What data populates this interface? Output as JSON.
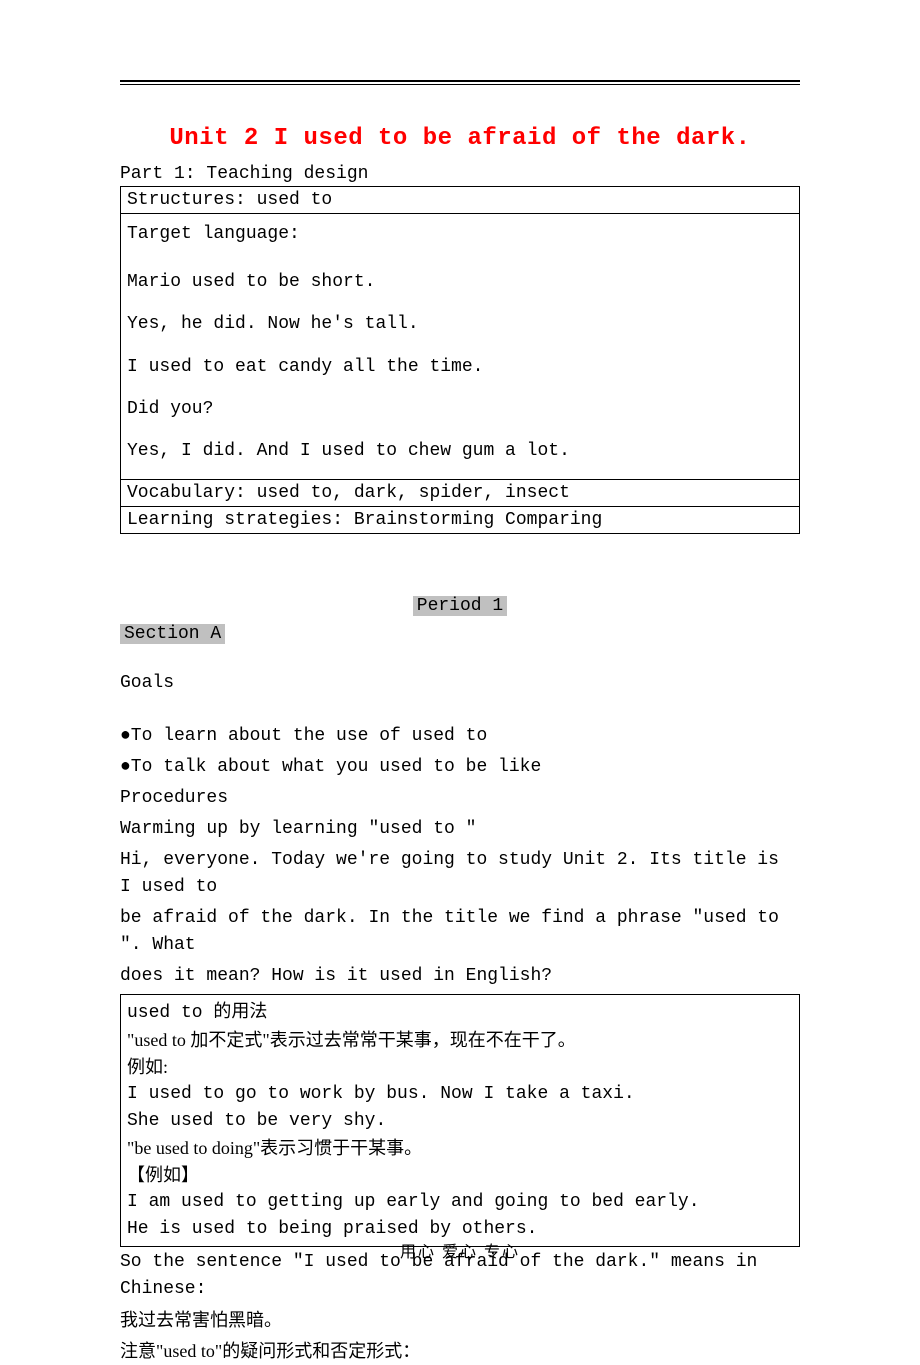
{
  "title": "Unit 2 I used to be afraid of the dark.",
  "part1_label": "Part 1: Teaching design",
  "table1": {
    "structures": "Structures: used to",
    "target_label": "Target language:",
    "target_lines": [
      "Mario used to be short.",
      "Yes, he did. Now he's tall.",
      "I used to eat candy all the time.",
      "Did you?",
      "Yes, I did. And I used to chew gum a lot."
    ],
    "vocabulary": "Vocabulary: used to, dark, spider, insect",
    "strategies": "Learning strategies: Brainstorming Comparing"
  },
  "period": "Period  1",
  "section_a": "Section A",
  "goals_label": "Goals",
  "goals": [
    "●To learn about the use of used to",
    "●To talk about what you used to be like"
  ],
  "procedures_label": "Procedures",
  "warming": "Warming up by learning \"used to \"",
  "intro_lines": [
    "Hi, everyone. Today we're going to study Unit 2. Its title is I used to",
    "be afraid of the dark. In the title we find a phrase  \"used to \". What",
    "does it mean? How is it used in English?"
  ],
  "usage_box": {
    "title": "used to 的用法",
    "line1": "\"used to 加不定式\"表示过去常常干某事，现在不在干了。",
    "line2": "例如:",
    "line3": "I used to go to work by bus. Now I take a taxi.",
    "line4": "She used to be very shy.",
    "line5": "\"be used to doing\"表示习惯于干某事。",
    "line6": "【例如】",
    "line7": "I am used to getting up early and going to bed early.",
    "line8": "He is used to being praised by others."
  },
  "conclusion_lines": [
    "So the sentence \"I used to be afraid of the dark.\" means in Chinese:",
    "我过去常害怕黑暗。",
    "注意\"used to\"的疑问形式和否定形式："
  ],
  "footer": "用心   爱心   专心"
}
